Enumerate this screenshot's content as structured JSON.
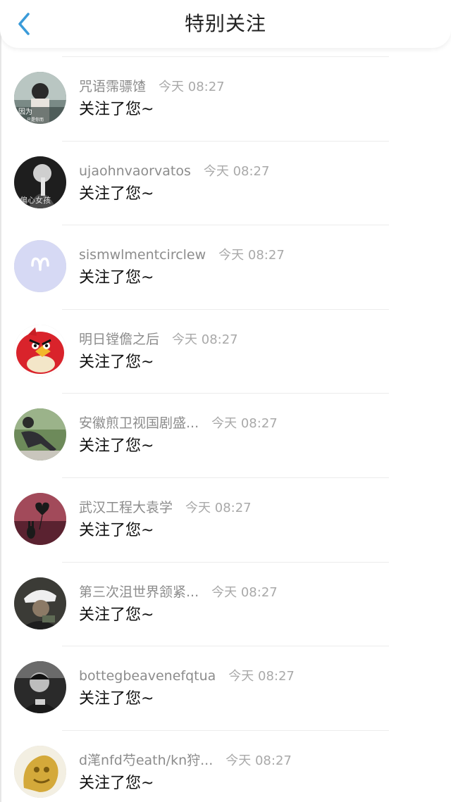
{
  "header": {
    "title": "特别关注",
    "back_icon": "chevron-left-icon",
    "accent_color": "#3a9bd9"
  },
  "items": [
    {
      "name": "咒语霈骠馇",
      "time": "今天 08:27",
      "message": "关注了您~"
    },
    {
      "name": "ujaohnvaorvatos",
      "time": "今天 08:27",
      "message": "关注了您~"
    },
    {
      "name": "sismwlmentcirclew",
      "time": "今天 08:27",
      "message": "关注了您~"
    },
    {
      "name": "明日镗儋之后",
      "time": "今天 08:27",
      "message": "关注了您~"
    },
    {
      "name": "安徽煎卫视国剧盛...",
      "time": "今天 08:27",
      "message": "关注了您~"
    },
    {
      "name": "武汉工程大袁学",
      "time": "今天 08:27",
      "message": "关注了您~"
    },
    {
      "name": "第三次沮世界颔紧...",
      "time": "今天 08:27",
      "message": "关注了您~"
    },
    {
      "name": "bottegbeavenefqtua",
      "time": "今天 08:27",
      "message": "关注了您~"
    },
    {
      "name": "d滗nfd芍eath/kn狩...",
      "time": "今天 08:27",
      "message": "关注了您~"
    }
  ]
}
